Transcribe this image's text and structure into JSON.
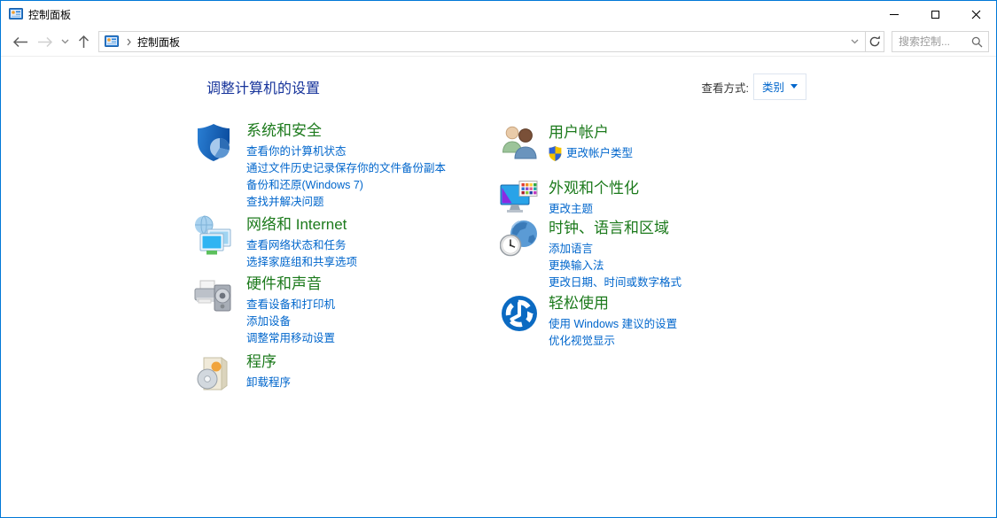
{
  "titlebar": {
    "app_title": "控制面板"
  },
  "navbar": {
    "breadcrumb_location": "控制面板",
    "search_placeholder": "搜索控制..."
  },
  "header": {
    "title": "调整计算机的设置",
    "view_by_label": "查看方式:",
    "view_by_value": "类别"
  },
  "categories": {
    "left": [
      {
        "title": "系统和安全",
        "icon": "security-shield-icon",
        "links": [
          "查看你的计算机状态",
          "通过文件历史记录保存你的文件备份副本",
          "备份和还原(Windows 7)",
          "查找并解决问题"
        ]
      },
      {
        "title": "网络和 Internet",
        "icon": "network-icon",
        "links": [
          "查看网络状态和任务",
          "选择家庭组和共享选项"
        ]
      },
      {
        "title": "硬件和声音",
        "icon": "hardware-sound-icon",
        "links": [
          "查看设备和打印机",
          "添加设备",
          "调整常用移动设置"
        ]
      },
      {
        "title": "程序",
        "icon": "programs-icon",
        "links": [
          "卸载程序"
        ]
      }
    ],
    "right": [
      {
        "title": "用户帐户",
        "icon": "user-accounts-icon",
        "links": [
          "更改帐户类型"
        ],
        "link_has_uac_shield": true
      },
      {
        "title": "外观和个性化",
        "icon": "appearance-icon",
        "links": [
          "更改主题"
        ]
      },
      {
        "title": "时钟、语言和区域",
        "icon": "clock-region-icon",
        "links": [
          "添加语言",
          "更换输入法",
          "更改日期、时间或数字格式"
        ]
      },
      {
        "title": "轻松使用",
        "icon": "ease-of-access-icon",
        "links": [
          "使用 Windows 建议的设置",
          "优化视觉显示"
        ]
      }
    ]
  },
  "icons": [
    "control-panel-icon",
    "minimize-icon",
    "maximize-icon",
    "close-icon",
    "back-icon",
    "forward-icon",
    "history-chevron-icon",
    "up-icon",
    "breadcrumb-chevron-icon",
    "address-dropdown-icon",
    "refresh-icon",
    "search-icon",
    "uac-shield-icon"
  ],
  "colors": {
    "window_border": "#0078D7",
    "category_green": "#1C7A1C",
    "link_blue": "#0066CC",
    "header_blue": "#17349B"
  }
}
